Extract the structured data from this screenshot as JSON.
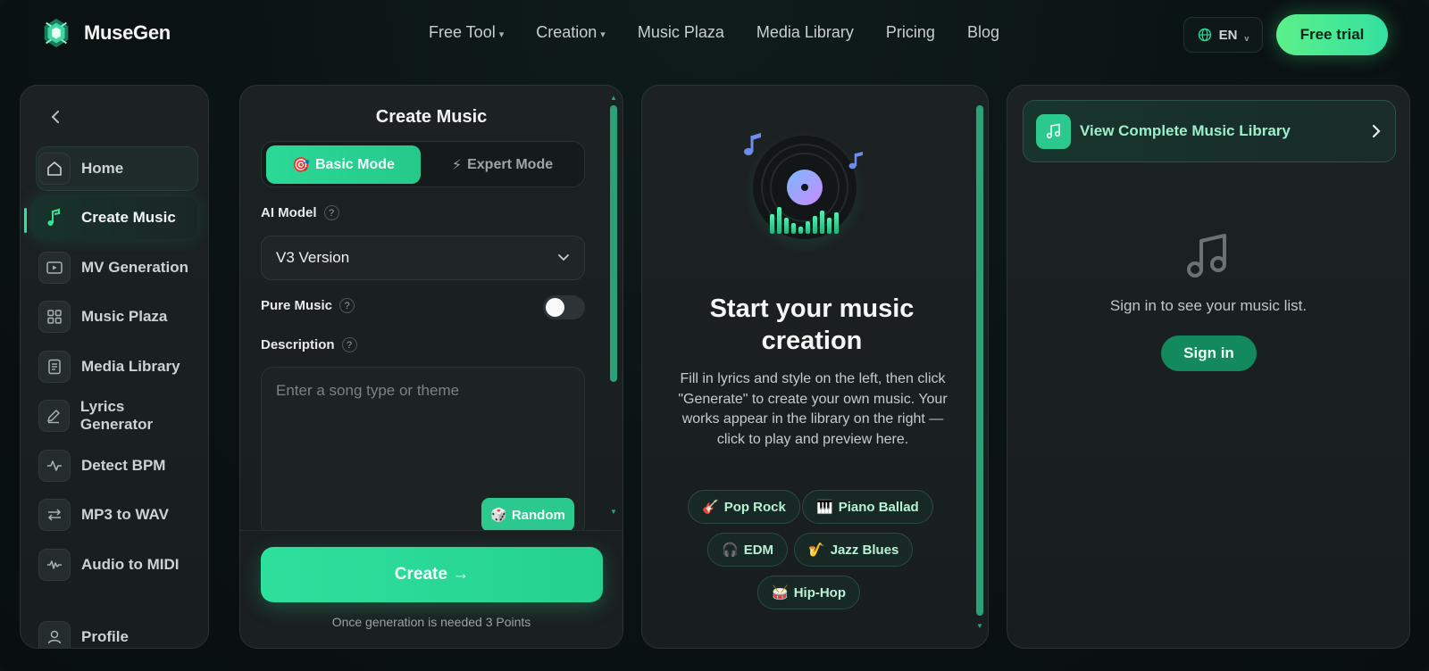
{
  "app": {
    "name": "MuseGen"
  },
  "header": {
    "nav": [
      {
        "label": "Free Tool",
        "has_caret": true
      },
      {
        "label": "Creation",
        "has_caret": true
      },
      {
        "label": "Music Plaza",
        "has_caret": false
      },
      {
        "label": "Media Library",
        "has_caret": false
      },
      {
        "label": "Pricing",
        "has_caret": false
      },
      {
        "label": "Blog",
        "has_caret": false
      }
    ],
    "language": "EN",
    "trial_label": "Free trial",
    "caret_glyph": "▾",
    "lang_caret_glyph": "v"
  },
  "sidebar": {
    "back_icon": "chevron-left-icon",
    "items": [
      {
        "label": "Home",
        "icon": "home-icon",
        "state": "hover"
      },
      {
        "label": "Create Music",
        "icon": "music-note-icon",
        "state": "active"
      },
      {
        "label": "MV Generation",
        "icon": "video-icon",
        "state": ""
      },
      {
        "label": "Music Plaza",
        "icon": "grid-icon",
        "state": ""
      },
      {
        "label": "Media Library",
        "icon": "document-icon",
        "state": ""
      },
      {
        "label": "Lyrics Generator",
        "icon": "pen-icon",
        "state": ""
      },
      {
        "label": "Detect BPM",
        "icon": "pulse-icon",
        "state": ""
      },
      {
        "label": "MP3 to WAV",
        "icon": "swap-icon",
        "state": ""
      },
      {
        "label": "Audio to MIDI",
        "icon": "waveform-icon",
        "state": ""
      },
      {
        "label": "Profile",
        "icon": "user-icon",
        "state": ""
      }
    ]
  },
  "create_panel": {
    "title": "Create Music",
    "modes": {
      "basic": {
        "label": "Basic Mode",
        "icon": "🎯",
        "selected": true
      },
      "expert": {
        "label": "Expert Mode",
        "icon": "⚡",
        "selected": false
      }
    },
    "ai_model": {
      "label": "AI Model",
      "help": "?",
      "value": "V3 Version"
    },
    "pure_music": {
      "label": "Pure Music",
      "help": "?",
      "enabled": false
    },
    "description": {
      "label": "Description",
      "help": "?",
      "placeholder": "Enter a song type or theme",
      "value": ""
    },
    "random": {
      "label": "Random",
      "icon": "🎲"
    },
    "create_label": "Create →",
    "points_note": "Once generation is needed 3 Points"
  },
  "middle_panel": {
    "title": "Start your music creation",
    "description": "Fill in lyrics and style on the left, then click \"Generate\" to create your own music. Your works appear in the library on the right — click to play and preview here.",
    "genres": [
      {
        "label": "Pop Rock",
        "icon": "🎸"
      },
      {
        "label": "Piano Ballad",
        "icon": "🎹"
      },
      {
        "label": "EDM",
        "icon": "🎧"
      },
      {
        "label": "Jazz Blues",
        "icon": "🎷"
      },
      {
        "label": "Hip-Hop",
        "icon": "🥁"
      }
    ]
  },
  "right_panel": {
    "library_label": "View Complete Music Library",
    "empty_note": "Sign in to see your music list.",
    "signin_label": "Sign in"
  },
  "colors": {
    "accent": "#2bd996",
    "accent_dark": "#138a5e",
    "trial_gradient_start": "#5cf08a",
    "panel_bg": "#1c2223",
    "page_bg": "#0b1414"
  }
}
